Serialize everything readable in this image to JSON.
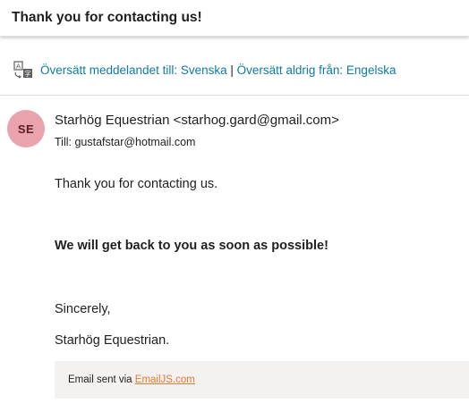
{
  "subject": "Thank you for contacting us!",
  "translate": {
    "icon": "translate-icon",
    "link_translate": "Översätt meddelandet till: Svenska",
    "separator": " | ",
    "link_never": "Översätt aldrig från: Engelska"
  },
  "message": {
    "avatar_initials": "SE",
    "avatar_color": "#eaa3ad",
    "sender": "Starhög Equestrian <starhog.gard@gmail.com>",
    "to_label": "Till:",
    "to_address": "gustafstar@hotmail.com",
    "body": {
      "line1": "Thank you for contacting us.",
      "line2": "We will get back to you as soon as possible!",
      "line3": "Sincerely,",
      "line4": "Starhög Equestrian."
    },
    "footer": {
      "prefix": "Email sent via ",
      "link": "EmailJS.com"
    }
  },
  "colors": {
    "link": "#0f7ba3",
    "footer_link": "#e8782e"
  }
}
